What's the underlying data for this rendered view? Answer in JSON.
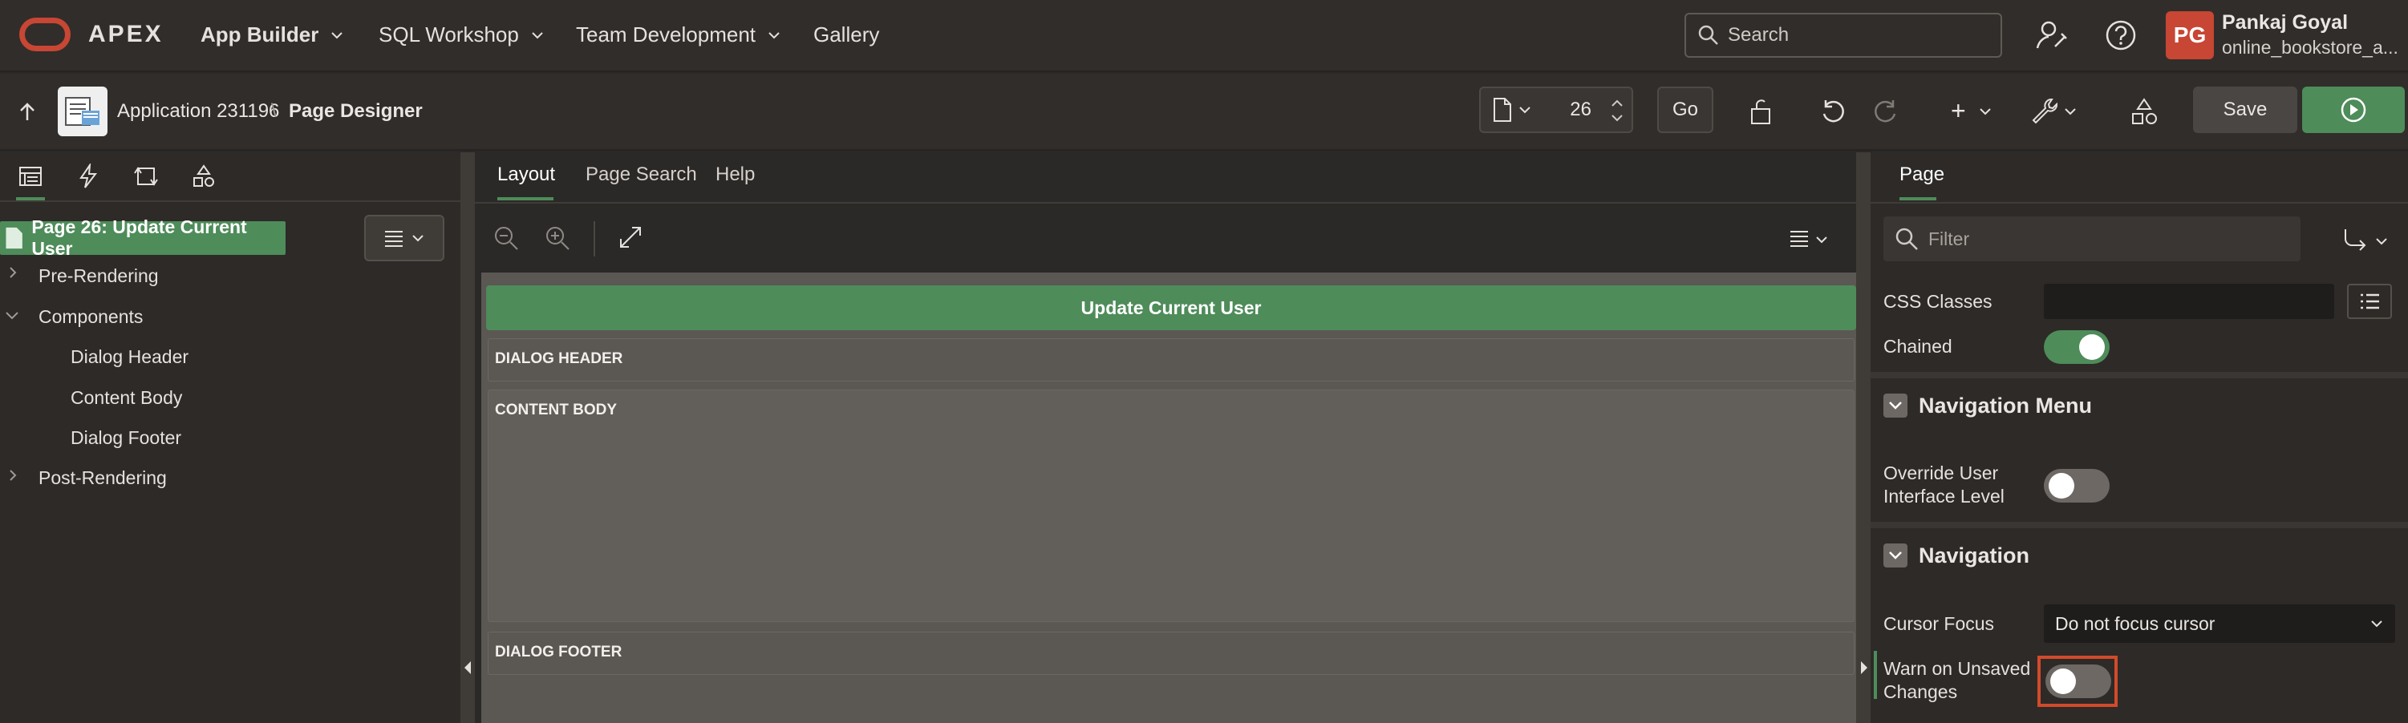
{
  "topnav": {
    "brand": "APEX",
    "items": [
      {
        "label": "App Builder",
        "active": true
      },
      {
        "label": "SQL Workshop"
      },
      {
        "label": "Team Development"
      },
      {
        "label": "Gallery"
      }
    ],
    "search_placeholder": "Search",
    "user": {
      "initials": "PG",
      "name": "Pankaj Goyal",
      "workspace": "online_bookstore_a..."
    },
    "brand_color": "#c74634"
  },
  "toolbar": {
    "app_label": "Application 231196",
    "separator": "\\",
    "page_label": "Page Designer",
    "page_number": "26",
    "go_label": "Go",
    "add_label": "+",
    "save_label": "Save",
    "accent_color": "#4e8c5a"
  },
  "left": {
    "page_node": "Page 26: Update Current User",
    "tree": [
      {
        "label": "Pre-Rendering",
        "level": 0,
        "expander": "collapsed"
      },
      {
        "label": "Components",
        "level": 0,
        "expander": "expanded"
      },
      {
        "label": "Dialog Header",
        "level": 1
      },
      {
        "label": "Content Body",
        "level": 1
      },
      {
        "label": "Dialog Footer",
        "level": 1
      },
      {
        "label": "Post-Rendering",
        "level": 0,
        "expander": "collapsed"
      }
    ]
  },
  "center": {
    "tabs": [
      "Layout",
      "Page Search",
      "Help"
    ],
    "active_tab": "Layout",
    "page_title": "Update Current User",
    "regions": [
      "DIALOG HEADER",
      "CONTENT BODY",
      "DIALOG FOOTER"
    ]
  },
  "right": {
    "tab": "Page",
    "filter_placeholder": "Filter",
    "props": {
      "css_classes": {
        "label": "CSS Classes",
        "value": ""
      },
      "chained": {
        "label": "Chained",
        "on": true
      },
      "override_ui_level": {
        "label_line1": "Override User",
        "label_line2": "Interface Level",
        "on": false
      },
      "cursor_focus": {
        "label": "Cursor Focus",
        "value": "Do not focus cursor"
      },
      "warn_unsaved": {
        "label_line1": "Warn on Unsaved",
        "label_line2": "Changes",
        "on": false
      }
    },
    "sections": [
      "Navigation Menu",
      "Navigation"
    ],
    "highlight_color": "#d14a2a"
  }
}
